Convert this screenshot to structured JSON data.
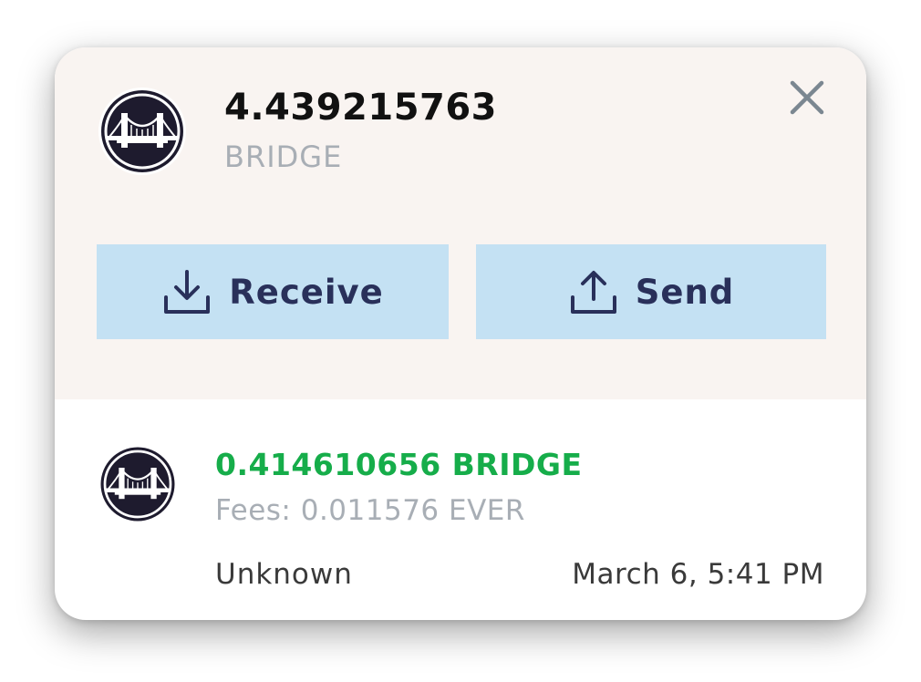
{
  "token": {
    "balance": "4.439215763",
    "symbol": "BRIDGE",
    "logo_icon": "bridge-icon"
  },
  "actions": {
    "receive_label": "Receive",
    "receive_icon": "download-icon",
    "send_label": "Send",
    "send_icon": "upload-icon"
  },
  "close_icon": "close-icon",
  "transaction": {
    "amount": "0.414610656 BRIDGE",
    "fees": "Fees: 0.011576 EVER",
    "status": "Unknown",
    "date": "March 6, 5:41 PM",
    "logo_icon": "bridge-icon"
  },
  "colors": {
    "top_background": "#f9f4f1",
    "button_background": "#c4e1f3",
    "button_text": "#29305a",
    "amount_green": "#16ad4a",
    "muted_text": "#a8aeb5",
    "logo_dark": "#1e1b2e"
  }
}
